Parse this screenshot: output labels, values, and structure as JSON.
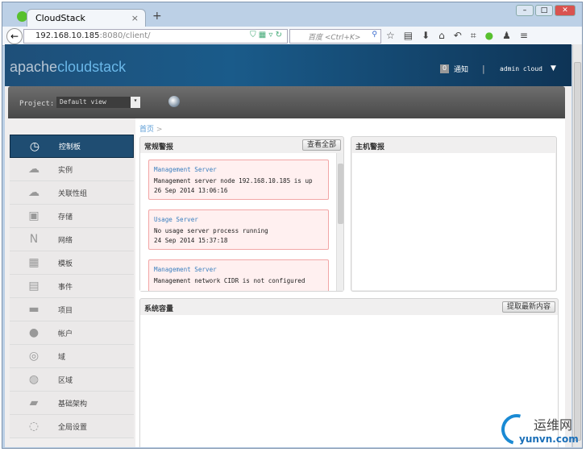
{
  "browser": {
    "tab_title": "CloudStack",
    "new_tab": "+",
    "url_host": "192.168.10.185",
    "url_rest": ":8080/client/",
    "search_placeholder": "百度 <Ctrl+K>"
  },
  "header": {
    "logo_a": "apache",
    "logo_b": "cloudstack",
    "notify_count": "0",
    "notify_label": "通知",
    "separator": "|",
    "user": "admin cloud"
  },
  "project": {
    "label": "Project:",
    "value": "Default view"
  },
  "sidebar": {
    "items": [
      {
        "label": "控制板",
        "icon": "dashboard-icon",
        "glyph": "◷"
      },
      {
        "label": "实例",
        "icon": "cloud-icon",
        "glyph": "☁"
      },
      {
        "label": "关联性组",
        "icon": "affinity-cloud-icon",
        "glyph": "☁"
      },
      {
        "label": "存储",
        "icon": "storage-icon",
        "glyph": "▣"
      },
      {
        "label": "网络",
        "icon": "network-icon",
        "glyph": "N"
      },
      {
        "label": "模板",
        "icon": "template-icon",
        "glyph": "▦"
      },
      {
        "label": "事件",
        "icon": "calendar-icon",
        "glyph": "▤"
      },
      {
        "label": "项目",
        "icon": "folder-icon",
        "glyph": "▬"
      },
      {
        "label": "帐户",
        "icon": "user-icon",
        "glyph": "●"
      },
      {
        "label": "域",
        "icon": "domain-icon",
        "glyph": "◎"
      },
      {
        "label": "区域",
        "icon": "globe-icon",
        "glyph": "◍"
      },
      {
        "label": "基础架构",
        "icon": "infrastructure-icon",
        "glyph": "▰"
      },
      {
        "label": "全局设置",
        "icon": "settings-globe-icon",
        "glyph": "◌"
      }
    ]
  },
  "breadcrumb": {
    "home": "首页",
    "sep": ">"
  },
  "general_alerts": {
    "title": "常规警报",
    "button": "查看全部",
    "items": [
      {
        "title": "Management Server",
        "message": "Management server node 192.168.10.185 is up",
        "time": "26 Sep 2014 13:06:16"
      },
      {
        "title": "Usage Server",
        "message": "No usage server process running",
        "time": "24 Sep 2014 15:37:18"
      },
      {
        "title": "Management Server",
        "message": "Management network CIDR is not configured",
        "time": ""
      }
    ]
  },
  "host_alerts": {
    "title": "主机警报"
  },
  "capacity": {
    "title": "系统容量",
    "button": "提取最新内容"
  },
  "watermark": {
    "cn": "运维网",
    "en": "yunvn.com"
  }
}
